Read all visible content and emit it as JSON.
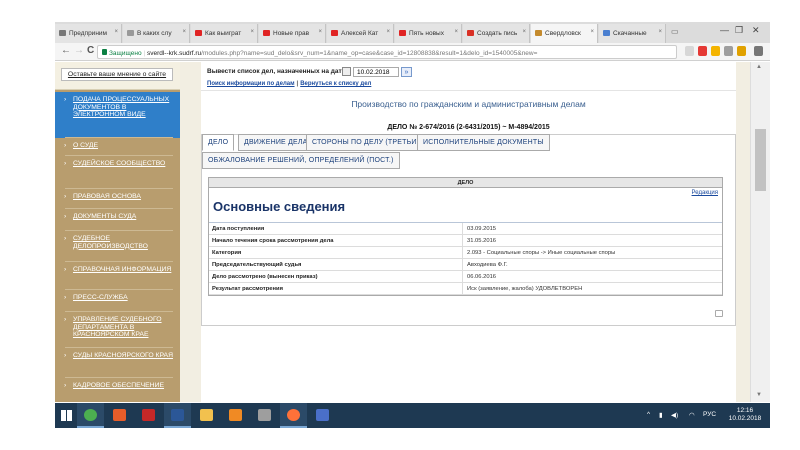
{
  "browser": {
    "tabs": [
      {
        "label": "Предприним",
        "color": "#777777"
      },
      {
        "label": "В каких слу",
        "color": "#999999"
      },
      {
        "label": "Как выиграт",
        "color": "#e02424"
      },
      {
        "label": "Новые прав",
        "color": "#e02424"
      },
      {
        "label": "Алексей Кат",
        "color": "#e02424"
      },
      {
        "label": "Пять новых",
        "color": "#e02424"
      },
      {
        "label": "Создать пись",
        "color": "#d93025"
      },
      {
        "label": "Свердловск",
        "color": "#c48a2d"
      },
      {
        "label": "Скачанные",
        "color": "#4a7fd0"
      }
    ],
    "back_glyph": "←",
    "forward_glyph": "→",
    "reload_glyph": "C",
    "secure_label": "Защищено",
    "url_host": "sverdl--krk.sudrf.ru",
    "url_path": "/modules.php?name=sud_delo&srv_num=1&name_op=case&case_id=12808838&result=1&delo_id=1540005&new="
  },
  "sidebar": {
    "feedback_button": "Оставьте ваше мнение о сайте",
    "items": [
      {
        "label": "ПОДАЧА ПРОЦЕССУАЛЬНЫХ ДОКУМЕНТОВ В ЭЛЕКТРОННОМ ВИДЕ",
        "active": true
      },
      {
        "label": "О СУДЕ",
        "active": false
      },
      {
        "label": "СУДЕЙСКОЕ СООБЩЕСТВО",
        "active": false
      },
      {
        "label": "ПРАВОВАЯ ОСНОВА",
        "active": false
      },
      {
        "label": "ДОКУМЕНТЫ СУДА",
        "active": false
      },
      {
        "label": "СУДЕБНОЕ ДЕЛОПРОИЗВОДСТВО",
        "active": false
      },
      {
        "label": "СПРАВОЧНАЯ ИНФОРМАЦИЯ",
        "active": false
      },
      {
        "label": "ПРЕСС-СЛУЖБА",
        "active": false
      },
      {
        "label": "УПРАВЛЕНИЕ СУДЕБНОГО ДЕПАРТАМЕНТА В КРАСНОЯРСКОМ КРАЕ",
        "active": false
      },
      {
        "label": "СУДЫ КРАСНОЯРСКОГО КРАЯ",
        "active": false
      },
      {
        "label": "КАДРОВОЕ ОБЕСПЕЧЕНИЕ",
        "active": false
      }
    ]
  },
  "case_search": {
    "label": "Вывести список дел, назначенных на дату",
    "date_value": "10.02.2018",
    "go_glyph": "»",
    "link_search": "Поиск информации по делам",
    "link_back": "Вернуться к списку дел"
  },
  "main": {
    "heading": "Производство по гражданским и административным делам",
    "case_number": "ДЕЛО № 2-674/2016 (2-6431/2015) ~ М-4894/2015",
    "tabs": [
      {
        "label": "ДЕЛО",
        "active": true
      },
      {
        "label": "ДВИЖЕНИЕ ДЕЛА",
        "active": false
      },
      {
        "label": "СТОРОНЫ ПО ДЕЛУ (ТРЕТЬИ ЛИЦА)",
        "active": false
      },
      {
        "label": "ИСПОЛНИТЕЛЬНЫЕ ДОКУМЕНТЫ",
        "active": false
      },
      {
        "label": "ОБЖАЛОВАНИЕ РЕШЕНИЙ, ОПРЕДЕЛЕНИЙ (ПОСТ.)",
        "active": false
      }
    ],
    "grid_header": "ДЕЛО",
    "edit_link": "Редакция",
    "section_title": "Основные сведения",
    "rows": [
      {
        "label": "Дата поступления",
        "value": "03.09.2015"
      },
      {
        "label": "Начало течения срока рассмотрения дела",
        "value": "31.05.2016"
      },
      {
        "label": "Категория",
        "value": "2.093 - Социальные споры -> Иные социальные споры"
      },
      {
        "label": "Председательствующий судья",
        "value": "Авходиева Ф.Г."
      },
      {
        "label": "Дело рассмотрено (вынесен приказ)",
        "value": "06.06.2016"
      },
      {
        "label": "Результат рассмотрения",
        "value": "Иск (заявление, жалоба) УДОВЛЕТВОРЕН"
      }
    ]
  },
  "taskbar": {
    "apps": [
      {
        "name": "windows-start",
        "color": "#ffffff"
      },
      {
        "name": "chrome",
        "color": "#4caf50"
      },
      {
        "name": "yandex",
        "color": "#e85d2a"
      },
      {
        "name": "app-red",
        "color": "#c62828"
      },
      {
        "name": "word",
        "color": "#2b5797"
      },
      {
        "name": "explorer",
        "color": "#f2c14e"
      },
      {
        "name": "app-orange",
        "color": "#f08a24"
      },
      {
        "name": "app-gray",
        "color": "#9e9e9e"
      },
      {
        "name": "firefox",
        "color": "#ff7139"
      },
      {
        "name": "app-blue",
        "color": "#4a6fc9"
      }
    ],
    "language": "РУС",
    "time": "12:16",
    "date": "10.02.2018"
  }
}
